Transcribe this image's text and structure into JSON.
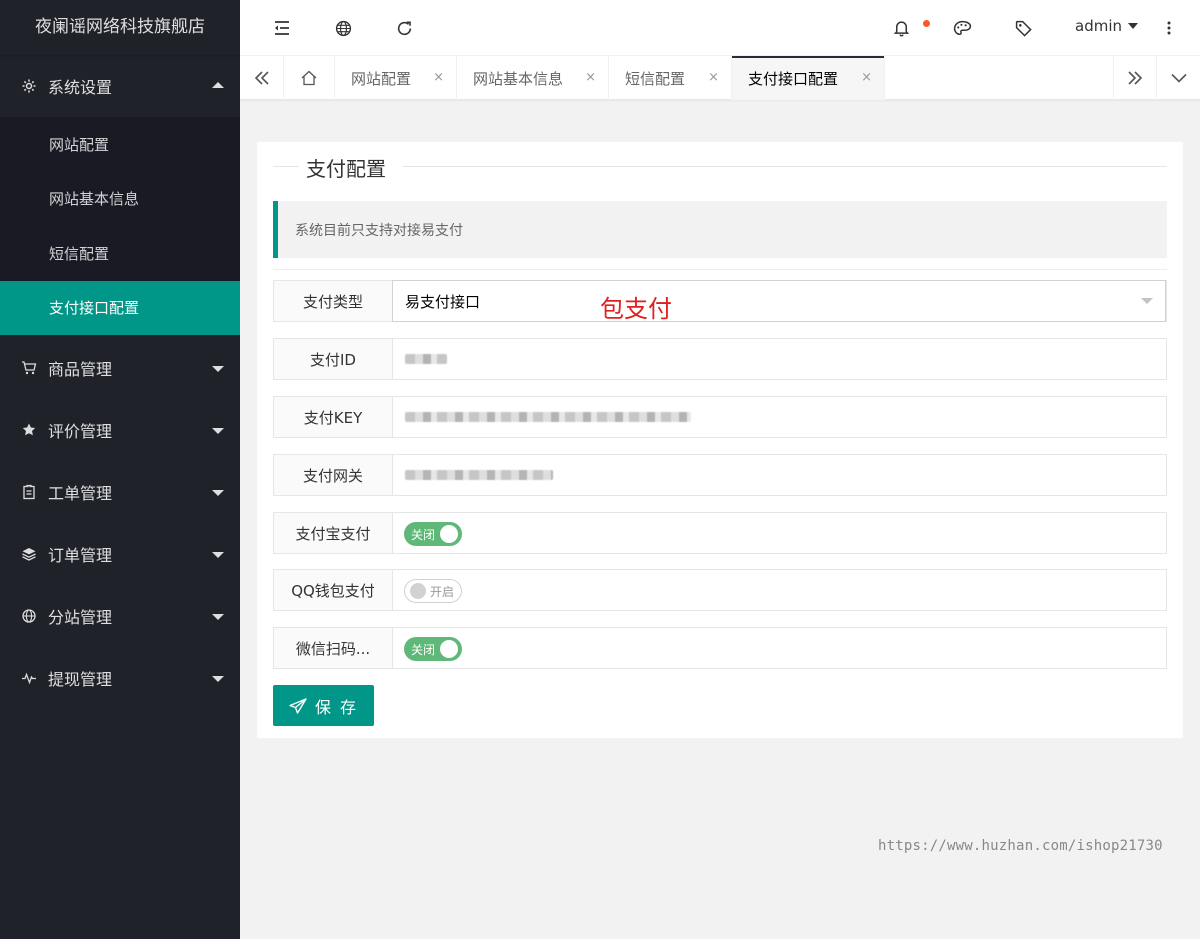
{
  "sidebar": {
    "brand": "夜阑谣网络科技旗舰店",
    "groups": [
      {
        "label": "系统设置",
        "icon": "gear-icon",
        "open": true,
        "items": [
          "网站配置",
          "网站基本信息",
          "短信配置",
          "支付接口配置"
        ],
        "active_index": 3
      },
      {
        "label": "商品管理",
        "icon": "cart-icon"
      },
      {
        "label": "评价管理",
        "icon": "star-icon"
      },
      {
        "label": "工单管理",
        "icon": "clipboard-icon"
      },
      {
        "label": "订单管理",
        "icon": "layers-icon"
      },
      {
        "label": "分站管理",
        "icon": "globe-icon"
      },
      {
        "label": "提现管理",
        "icon": "pulse-icon"
      }
    ]
  },
  "header": {
    "user": "admin",
    "icons": [
      "menu-collapse-icon",
      "globe-icon",
      "refresh-icon",
      "bell-icon",
      "palette-icon",
      "tag-icon",
      "more-vertical-icon"
    ],
    "notification_dot_color": "#ff5722"
  },
  "tabs": {
    "items": [
      {
        "label": "网站配置"
      },
      {
        "label": "网站基本信息"
      },
      {
        "label": "短信配置"
      },
      {
        "label": "支付接口配置",
        "active": true
      }
    ],
    "close_glyph": "×"
  },
  "card": {
    "title": "支付配置",
    "notice": "系统目前只支持对接易支付",
    "annotation": "包支付",
    "fields": {
      "pay_type": {
        "label": "支付类型",
        "value": "易支付接口"
      },
      "pay_id": {
        "label": "支付ID"
      },
      "pay_key": {
        "label": "支付KEY"
      },
      "pay_gateway": {
        "label": "支付网关"
      },
      "alipay": {
        "label": "支付宝支付",
        "switch_text": "关闭",
        "state": "on"
      },
      "qqpay": {
        "label": "QQ钱包支付",
        "switch_text": "开启",
        "state": "off"
      },
      "wxpay": {
        "label": "微信扫码...",
        "switch_text": "关闭",
        "state": "on"
      }
    },
    "save_label": "保 存"
  },
  "watermark": "https://www.huzhan.com/ishop21730",
  "colors": {
    "accent": "#009688",
    "sidebar_bg": "#20222a",
    "switch_on": "#5fb878",
    "annotation": "#e02020"
  }
}
